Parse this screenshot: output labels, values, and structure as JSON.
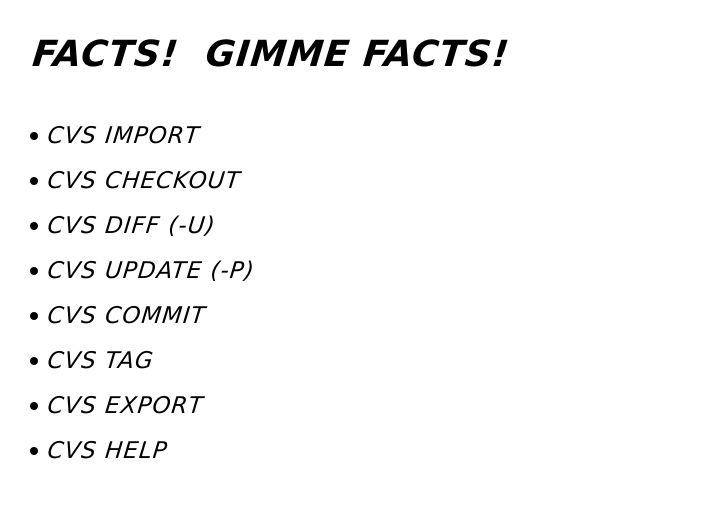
{
  "slide": {
    "title": "Facts!  Gimme Facts!",
    "bullets": [
      "cvs import",
      "cvs checkout",
      "cvs diff (-u)",
      "cvs update (-P)",
      "cvs commit",
      "cvs tag",
      "cvs export",
      "cvs help"
    ]
  }
}
